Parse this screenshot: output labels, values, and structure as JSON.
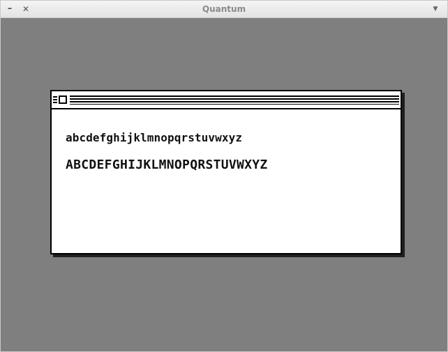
{
  "window": {
    "title": "Quantum",
    "controls": {
      "minimize_glyph": "–",
      "close_glyph": "✕",
      "menu_glyph": "▼"
    },
    "background_color": "#7f7f7f"
  },
  "classic_window": {
    "icons": [
      "grip-icon",
      "close-box-icon"
    ],
    "lowercase_sample": "abcdefghijklmnopqrstuvwxyz",
    "uppercase_sample": "ABCDEFGHIJKLMNOPQRSTUVWXYZ"
  }
}
